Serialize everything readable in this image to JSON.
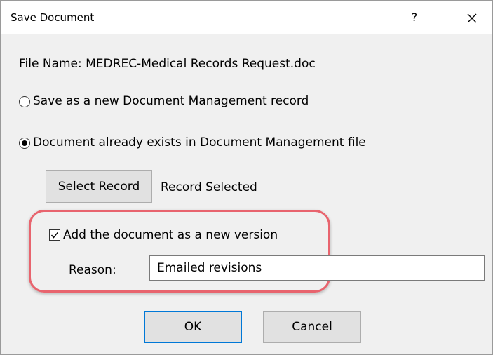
{
  "window": {
    "title": "Save Document",
    "help_label": "?"
  },
  "file_name_label": "File Name: MEDREC-Medical Records Request.doc",
  "options": {
    "new_record": {
      "label": "Save as a new Document Management record",
      "selected": false
    },
    "existing_record": {
      "label": "Document already exists in Document Management file",
      "selected": true
    }
  },
  "select_record_button": "Select Record",
  "record_status": "Record Selected",
  "new_version": {
    "label": "Add the document as a new version",
    "checked": true
  },
  "reason": {
    "label": "Reason:",
    "value": "Emailed revisions"
  },
  "buttons": {
    "ok": "OK",
    "cancel": "Cancel"
  },
  "colors": {
    "highlight": "#e8646e",
    "default_button_border": "#0078d7"
  },
  "icons": {
    "close": "close-icon",
    "checkmark": "checkmark-icon"
  }
}
